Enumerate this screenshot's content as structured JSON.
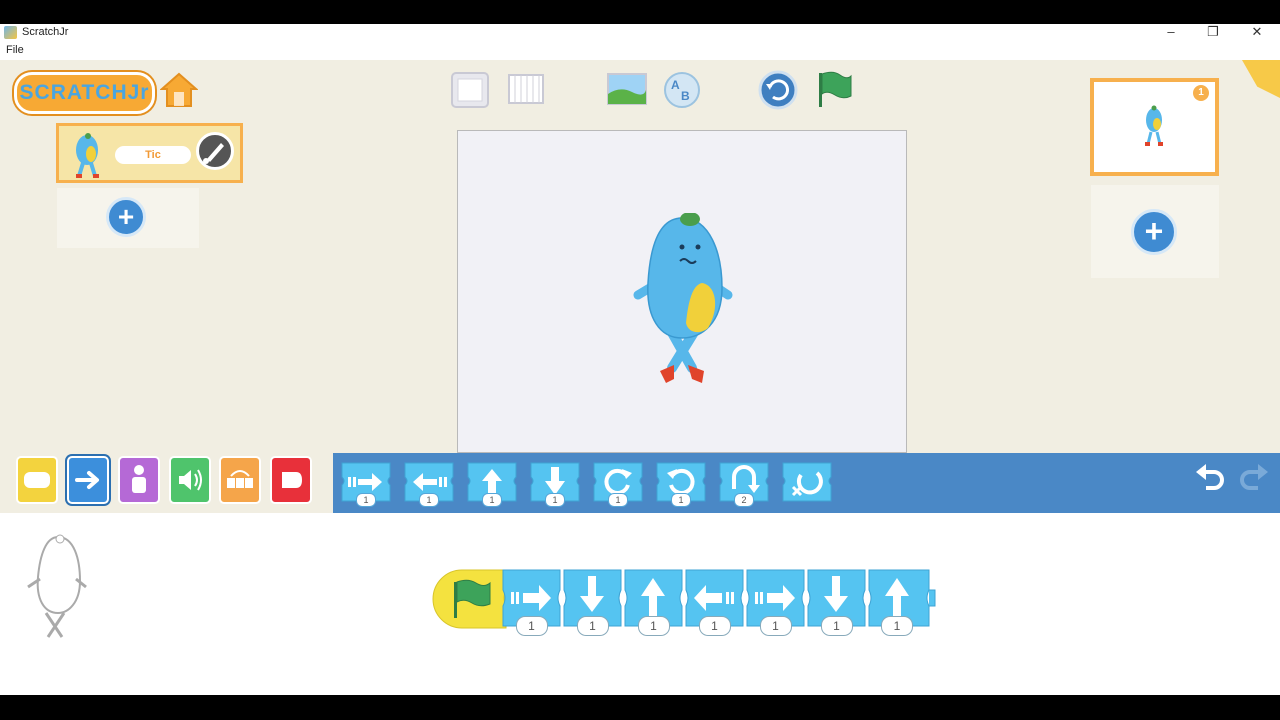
{
  "window": {
    "title": "ScratchJr",
    "min_icon": "minimize-icon",
    "max_icon": "restore-icon",
    "close_icon": "close-icon"
  },
  "menu": {
    "file": "File"
  },
  "app": {
    "logo_text": "SCRATCHJr"
  },
  "sprite": {
    "name": "Tic"
  },
  "pages": [
    {
      "number": "1"
    }
  ],
  "colors": {
    "triggering": "#f3d33e",
    "motion": "#3c8fdc",
    "looks": "#b569d6",
    "sound": "#4fc46c",
    "control": "#f5a54a",
    "end": "#e8303a",
    "block": "#55c4f1",
    "palette_bg": "#4a88c6"
  },
  "categories": [
    {
      "name": "triggering",
      "icon": "triggering-category-icon"
    },
    {
      "name": "motion",
      "icon": "motion-category-icon"
    },
    {
      "name": "looks",
      "icon": "looks-category-icon"
    },
    {
      "name": "sound",
      "icon": "sound-category-icon"
    },
    {
      "name": "control",
      "icon": "control-category-icon"
    },
    {
      "name": "end",
      "icon": "end-category-icon"
    }
  ],
  "palette_blocks": [
    {
      "name": "move-right",
      "value": "1"
    },
    {
      "name": "move-left",
      "value": "1"
    },
    {
      "name": "move-up",
      "value": "1"
    },
    {
      "name": "move-down",
      "value": "1"
    },
    {
      "name": "turn-right",
      "value": "1"
    },
    {
      "name": "turn-left",
      "value": "1"
    },
    {
      "name": "hop",
      "value": "2"
    },
    {
      "name": "go-home",
      "value": ""
    }
  ],
  "script_blocks": [
    {
      "name": "move-right",
      "value": "1"
    },
    {
      "name": "move-down",
      "value": "1"
    },
    {
      "name": "move-up",
      "value": "1"
    },
    {
      "name": "move-left",
      "value": "1"
    },
    {
      "name": "move-right",
      "value": "1"
    },
    {
      "name": "move-down",
      "value": "1"
    },
    {
      "name": "move-up",
      "value": "1"
    }
  ]
}
